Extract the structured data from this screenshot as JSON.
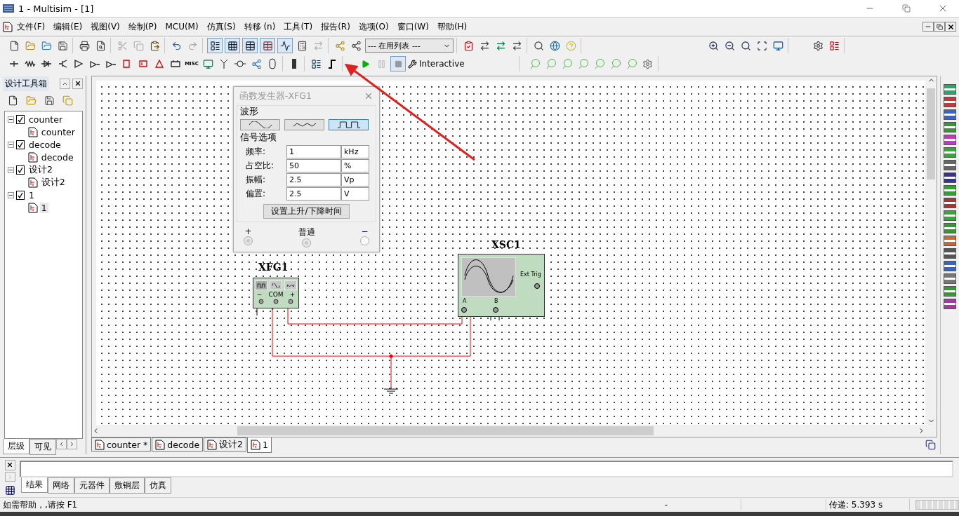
{
  "window": {
    "title": "1 - Multisim - [1]"
  },
  "menu": [
    "文件(F)",
    "编辑(E)",
    "视图(V)",
    "绘制(P)",
    "MCU(M)",
    "仿真(S)",
    "转移 (n)",
    "工具(T)",
    "报告(R)",
    "选项(O)",
    "窗口(W)",
    "帮助(H)"
  ],
  "toolbar": {
    "dropdown": "--- 在用列表 ---",
    "misc_label": "MISC",
    "mode": "Interactive"
  },
  "design_toolbox": {
    "title": "设计工具箱",
    "tree": [
      {
        "label": "counter",
        "checked": true,
        "expanded": true,
        "children": [
          {
            "label": "counter",
            "selected": false
          }
        ]
      },
      {
        "label": "decode",
        "checked": true,
        "expanded": true,
        "children": [
          {
            "label": "decode",
            "selected": false
          }
        ]
      },
      {
        "label": "设计2",
        "checked": true,
        "expanded": true,
        "children": [
          {
            "label": "设计2",
            "selected": false
          }
        ]
      },
      {
        "label": "1",
        "checked": true,
        "expanded": true,
        "children": [
          {
            "label": "1",
            "selected": true
          }
        ]
      }
    ],
    "tabs": [
      {
        "label": "层级",
        "selected": true
      },
      {
        "label": "可见",
        "selected": false
      }
    ]
  },
  "dialog": {
    "title": "函数发生器-XFG1",
    "waveform_label": "波形",
    "waveforms": [
      {
        "kind": "sine",
        "selected": false
      },
      {
        "kind": "triangle",
        "selected": false
      },
      {
        "kind": "square",
        "selected": true
      }
    ],
    "options_label": "信号选项",
    "fields": [
      {
        "label": "频率:",
        "value": "1",
        "unit": "kHz"
      },
      {
        "label": "占空比:",
        "value": "50",
        "unit": "%"
      },
      {
        "label": "振幅:",
        "value": "2.5",
        "unit": "Vp"
      },
      {
        "label": "偏置:",
        "value": "2.5",
        "unit": "V"
      }
    ],
    "button": "设置上升/下降时间",
    "terminals": [
      {
        "label": "+",
        "disabled": true
      },
      {
        "label": "普通",
        "disabled": true
      },
      {
        "label": "−",
        "disabled": false
      }
    ]
  },
  "schematic": {
    "generator": {
      "label": "XFG1",
      "pins": [
        "−",
        "COM",
        "+"
      ]
    },
    "scope": {
      "label": "XSC1",
      "trigger": "Ext Trig",
      "channels": [
        "A",
        "B"
      ]
    }
  },
  "sheet_tabs": [
    {
      "label": "counter *",
      "selected": false
    },
    {
      "label": "decode",
      "selected": false
    },
    {
      "label": "设计2",
      "selected": false
    },
    {
      "label": "1",
      "selected": true
    }
  ],
  "spreadsheet": {
    "tabs": [
      {
        "label": "结果",
        "selected": true
      },
      {
        "label": "网络",
        "selected": false
      },
      {
        "label": "元器件",
        "selected": false
      },
      {
        "label": "敷铜层",
        "selected": false
      },
      {
        "label": "仿真",
        "selected": false
      }
    ]
  },
  "status_bar": {
    "help": "如需帮助，,请按 F1",
    "indicator": "-",
    "transfer": "传递: 5.393 s"
  }
}
